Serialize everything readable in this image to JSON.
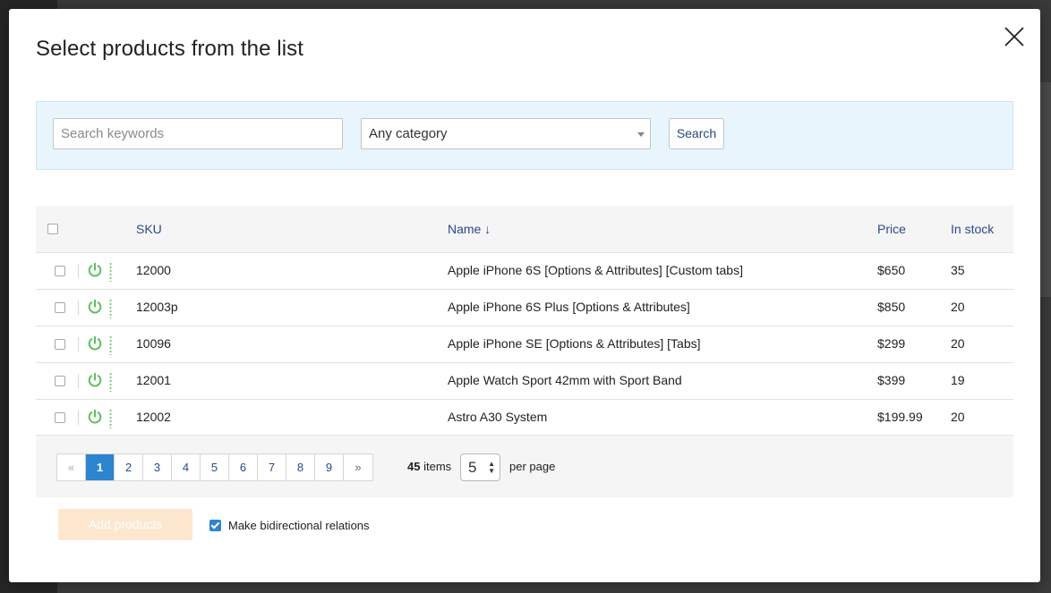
{
  "dialog": {
    "title": "Select products from the list"
  },
  "search": {
    "placeholder": "Search keywords",
    "value": "",
    "category_selected": "Any category",
    "search_button_label": "Search"
  },
  "table": {
    "headers": {
      "sku": "SKU",
      "name": "Name ↓",
      "price": "Price",
      "stock": "In stock"
    },
    "rows": [
      {
        "sku": "12000",
        "name": "Apple iPhone 6S [Options & Attributes] [Custom tabs]",
        "price": "$650",
        "stock": "35",
        "enabled": true
      },
      {
        "sku": "12003p",
        "name": "Apple iPhone 6S Plus [Options & Attributes]",
        "price": "$850",
        "stock": "20",
        "enabled": true
      },
      {
        "sku": "10096",
        "name": "Apple iPhone SE [Options & Attributes] [Tabs]",
        "price": "$299",
        "stock": "20",
        "enabled": true
      },
      {
        "sku": "12001",
        "name": "Apple Watch Sport 42mm with Sport Band",
        "price": "$399",
        "stock": "19",
        "enabled": true
      },
      {
        "sku": "12002",
        "name": "Astro A30 System",
        "price": "$199.99",
        "stock": "20",
        "enabled": true
      }
    ]
  },
  "pagination": {
    "prev": "«",
    "pages": [
      "1",
      "2",
      "3",
      "4",
      "5",
      "6",
      "7",
      "8",
      "9"
    ],
    "current": "1",
    "next": "»",
    "items_count": "45",
    "items_label": "items",
    "per_page_value": "5",
    "per_page_label": "per page"
  },
  "footer": {
    "add_button_label": "Add products",
    "bidirectional_label": "Make bidirectional relations",
    "bidirectional_checked": true
  },
  "colors": {
    "accent": "#2d84cf",
    "power_on": "#5cc05c",
    "add_button_disabled": "#fde7cf",
    "search_panel_bg": "#e8f5fd"
  }
}
